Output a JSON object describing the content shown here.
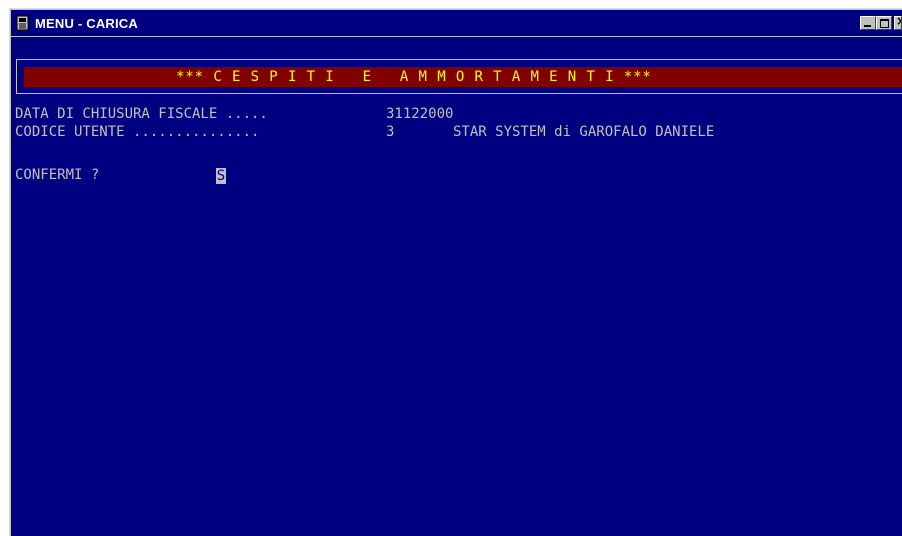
{
  "window": {
    "title": "MENU - CARICA",
    "icon": "console-app-icon"
  },
  "header": {
    "text": "*** C E S P I T I   E   A M M O R T A M E N T I ***"
  },
  "fields": {
    "fiscal_close_label": "DATA DI CHIUSURA FISCALE .....",
    "fiscal_close_value": "31122000",
    "user_code_label": "CODICE UTENTE ...............",
    "user_code_value": "3",
    "user_name": "STAR SYSTEM di GAROFALO DANIELE"
  },
  "prompt": {
    "label": "CONFERMI ?",
    "value": "S"
  },
  "colors": {
    "console_background": "#000080",
    "console_text": "#c0c0c0",
    "header_band": "#800000",
    "header_text": "#ffff00",
    "titlebar": "#000080"
  }
}
